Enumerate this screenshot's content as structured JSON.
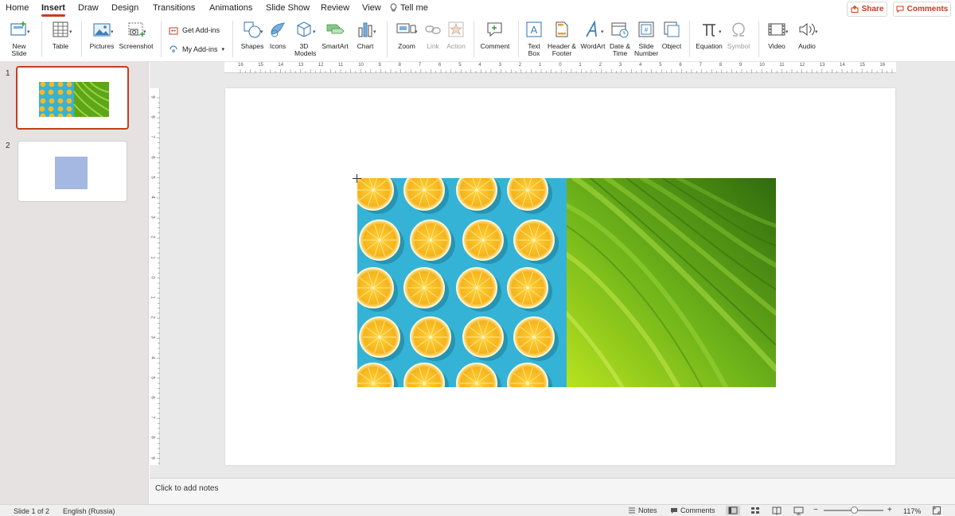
{
  "menu": {
    "tabs": [
      "Home",
      "Insert",
      "Draw",
      "Design",
      "Transitions",
      "Animations",
      "Slide Show",
      "Review",
      "View",
      "Tell me"
    ],
    "active_tab": "Insert",
    "share_label": "Share",
    "comments_label": "Comments"
  },
  "ribbon": {
    "new_slide": "New Slide",
    "table": "Table",
    "pictures": "Pictures",
    "screenshot": "Screenshot",
    "get_addins": "Get Add-ins",
    "my_addins": "My Add-ins",
    "shapes": "Shapes",
    "icons": "Icons",
    "models_3d": "3D Models",
    "smartart": "SmartArt",
    "chart": "Chart",
    "zoom": "Zoom",
    "link": "Link",
    "action": "Action",
    "comment": "Comment",
    "text_box": "Text Box",
    "header_footer": "Header & Footer",
    "wordart": "WordArt",
    "date_time": "Date & Time",
    "slide_number": "Slide Number",
    "object": "Object",
    "equation": "Equation",
    "symbol": "Symbol",
    "video": "Video",
    "audio": "Audio"
  },
  "thumbnails": {
    "slide1_number": "1",
    "slide2_number": "2"
  },
  "ruler": {
    "horizontal": [
      "16",
      "15",
      "14",
      "13",
      "12",
      "11",
      "10",
      "9",
      "8",
      "7",
      "6",
      "5",
      "4",
      "3",
      "2",
      "1",
      "0",
      "1",
      "2",
      "3",
      "4",
      "5",
      "6",
      "7",
      "8",
      "9",
      "10",
      "11",
      "12",
      "13",
      "14",
      "15",
      "16"
    ],
    "vertical": [
      "9",
      "8",
      "7",
      "6",
      "5",
      "4",
      "3",
      "2",
      "1",
      "0",
      "1",
      "2",
      "3",
      "4",
      "5",
      "6",
      "7",
      "8",
      "9"
    ]
  },
  "notes": {
    "placeholder": "Click to add notes"
  },
  "status": {
    "slide_info": "Slide 1 of 2",
    "language": "English (Russia)",
    "notes_label": "Notes",
    "comments_label": "Comments",
    "zoom_level": "117%"
  },
  "colors": {
    "accent": "#c43e1c",
    "orange_background": "#35b3d6",
    "leaf_green": "#6fb41a",
    "slide2_shape": "#a4b8e1"
  }
}
